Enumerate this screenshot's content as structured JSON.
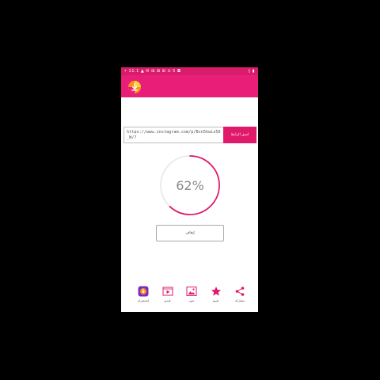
{
  "status_bar": {
    "left_text": "• 11:1 ▲ ✉ ⊞ ⊞ ⊞ ⊙ 5 ◘",
    "right_text": "▯ ▮"
  },
  "app": {
    "accent": "#e91e78",
    "icon_name": "app-logo-icon"
  },
  "url_field": {
    "value": "https://www.instagram.com/p/Bcn5kwiz56_W/?"
  },
  "paste_button": {
    "label": "لصق الرابط"
  },
  "progress": {
    "value": 62,
    "label": "62%"
  },
  "action_button": {
    "label": "إيقاف"
  },
  "bottom_nav": [
    {
      "label": "إنستقرام",
      "icon": "instagram-icon"
    },
    {
      "label": "فيديو",
      "icon": "video-icon"
    },
    {
      "label": "صور",
      "icon": "image-icon"
    },
    {
      "label": "تقييم",
      "icon": "star-icon"
    },
    {
      "label": "مشاركة",
      "icon": "share-icon"
    }
  ]
}
